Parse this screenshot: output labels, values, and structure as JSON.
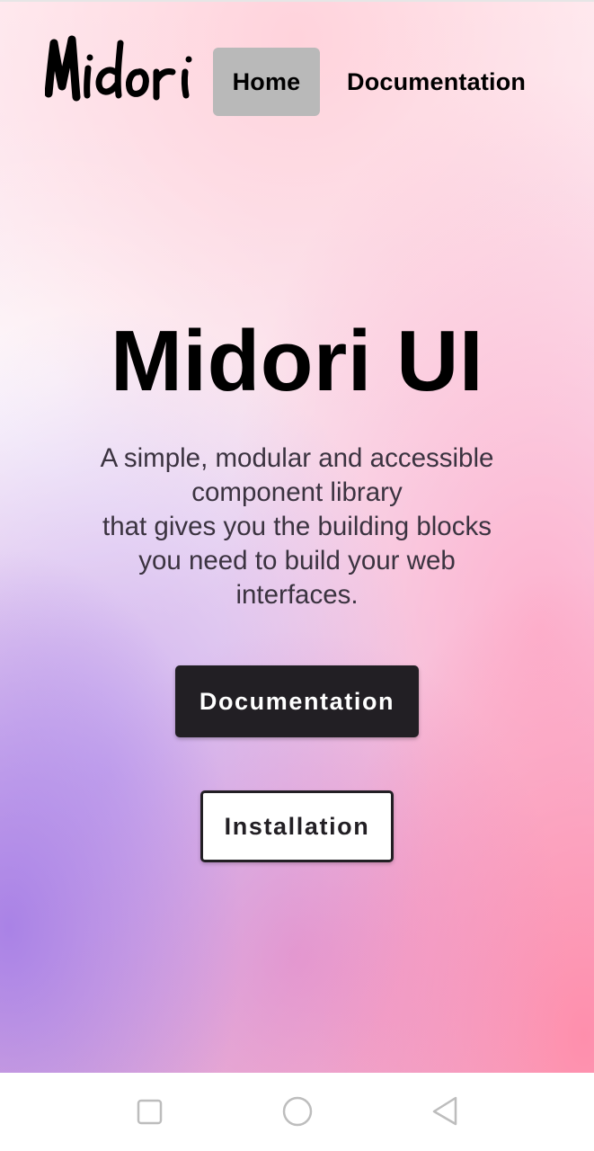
{
  "header": {
    "logo_text": "Midori",
    "nav": {
      "home_label": "Home",
      "docs_label": "Documentation"
    }
  },
  "hero": {
    "title": "Midori UI",
    "description_lines": [
      "A simple, modular and accessible",
      "component library",
      "that gives you the building blocks",
      "you need to build your web",
      "interfaces."
    ],
    "primary_button": "Documentation",
    "secondary_button": "Installation"
  },
  "system_nav": {
    "icons": [
      "recents-square-icon",
      "home-circle-icon",
      "back-triangle-icon"
    ]
  },
  "colors": {
    "text_dark": "#221f24",
    "nav_active_bg": "#b9b9b9",
    "gradient_purple": "#a078e6",
    "gradient_pink": "#ff8caa"
  }
}
